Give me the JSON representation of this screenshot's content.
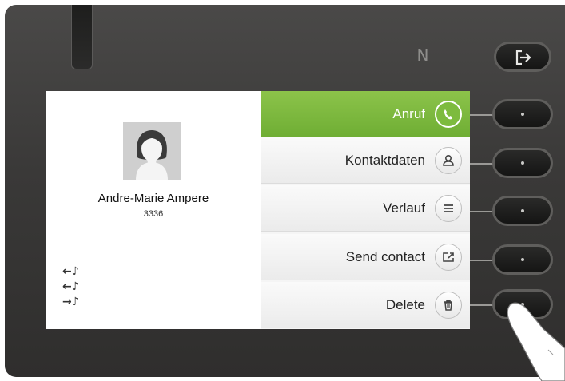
{
  "contact": {
    "name": "Andre-Marie Ampere",
    "number": "3336",
    "avatar_icon": "person-avatar"
  },
  "call_history": [
    {
      "direction": "incoming",
      "icon": "incoming-call-icon",
      "glyph": "←♪"
    },
    {
      "direction": "incoming",
      "icon": "incoming-call-icon",
      "glyph": "←♪"
    },
    {
      "direction": "outgoing",
      "icon": "outgoing-call-icon",
      "glyph": "→♪"
    }
  ],
  "menu": {
    "items": [
      {
        "label": "Anruf",
        "icon": "phone-icon",
        "selected": true
      },
      {
        "label": "Kontaktdaten",
        "icon": "contact-icon",
        "selected": false
      },
      {
        "label": "Verlauf",
        "icon": "list-icon",
        "selected": false
      },
      {
        "label": "Send contact",
        "icon": "share-icon",
        "selected": false
      },
      {
        "label": "Delete",
        "icon": "trash-icon",
        "selected": false
      }
    ]
  },
  "device": {
    "nfc_symbol": "N",
    "exit_icon": "exit-icon"
  },
  "colors": {
    "accent": "#7dbb3e",
    "bezel": "#3a3938",
    "screen_bg": "#ffffff"
  }
}
